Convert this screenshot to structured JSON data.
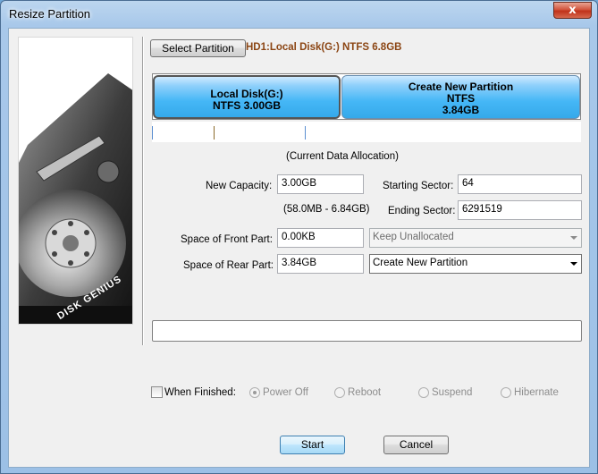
{
  "window": {
    "title": "Resize Partition",
    "close_glyph": "x"
  },
  "toolbar": {
    "select_partition_label": "Select Partition",
    "disk_label": "HD1:Local Disk(G:) NTFS 6.8GB"
  },
  "partitions": [
    {
      "name": "Local Disk(G:)",
      "info": "NTFS 3.00GB",
      "size": ""
    },
    {
      "name": "Create New Partition",
      "info": "NTFS",
      "size": "3.84GB"
    }
  ],
  "allocation_caption": "(Current Data Allocation)",
  "form": {
    "new_capacity_label": "New Capacity:",
    "new_capacity_value": "3.00GB",
    "capacity_range": "(58.0MB - 6.84GB)",
    "starting_sector_label": "Starting Sector:",
    "starting_sector_value": "64",
    "ending_sector_label": "Ending Sector:",
    "ending_sector_value": "6291519",
    "front_label": "Space of Front Part:",
    "front_value": "0.00KB",
    "front_action": "Keep Unallocated",
    "rear_label": "Space of Rear Part:",
    "rear_value": "3.84GB",
    "rear_action": "Create New Partition"
  },
  "when_finished": {
    "label": "When Finished:",
    "checked": false,
    "options": [
      "Power Off",
      "Reboot",
      "Suspend",
      "Hibernate"
    ],
    "selected": "Power Off"
  },
  "buttons": {
    "start": "Start",
    "cancel": "Cancel"
  },
  "art": {
    "brand": "DISK GENIUS"
  },
  "colors": {
    "partition_fill": "#45b7f6",
    "disk_label": "#8b4513",
    "close": "#c0321a"
  }
}
